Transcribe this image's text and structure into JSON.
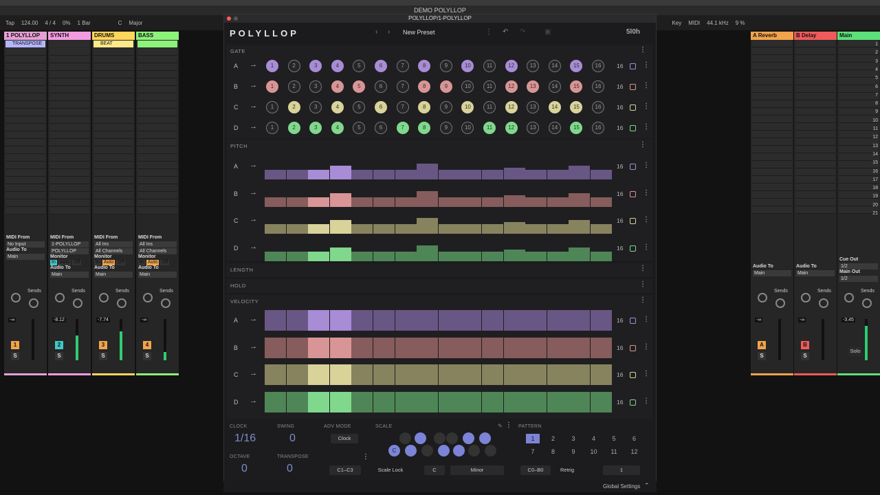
{
  "window": {
    "app_title": "DEMO POLYLLOP",
    "plugin_title": "POLYLLOP/1-POLYLLOP"
  },
  "transport": {
    "tap": "Tap",
    "bpm": "124.00",
    "sig": "4 / 4",
    "zoom": "0%",
    "quant": "1 Bar",
    "key": "C",
    "scale": "Major",
    "key_label": "Key",
    "midi": "MIDI",
    "rate": "44.1 kHz",
    "cpu": "9 %"
  },
  "tracks": [
    {
      "name": "1 POLYLLOP",
      "color": "#e6a0d6",
      "clip": "TRANSPOSE",
      "clip_color": "#b5b5ff",
      "from_label": "MIDI From",
      "from": "No Input",
      "audio_to": "Audio To",
      "out": "Main",
      "num": "1",
      "vol": "-∞",
      "num_color": "#f2a34b",
      "s": "S"
    },
    {
      "name": "SYNTH",
      "color": "#f39be0",
      "clip": "",
      "clip_color": "",
      "from_label": "MIDI From",
      "from": "1-POLYLLOP",
      "from2": "POLYLLOP",
      "monitor": "Monitor",
      "mon": [
        "In",
        "Auto",
        "Off"
      ],
      "audio_to": "Audio To",
      "out": "Main",
      "num": "2",
      "vol": "-8.12",
      "num_color": "#3fc8c8",
      "s": "S"
    },
    {
      "name": "DRUMS",
      "color": "#ffd65c",
      "clip": "BEAT",
      "clip_color": "#ffe88a",
      "from_label": "MIDI From",
      "from": "All Ins",
      "from2": "All Channels",
      "monitor": "Monitor",
      "mon": [
        "In",
        "Auto",
        "Off"
      ],
      "audio_to": "Audio To",
      "out": "Main",
      "num": "3",
      "vol": "-7.74",
      "num_color": "#f2a34b",
      "s": "S",
      "scene": [
        "5",
        "8"
      ]
    },
    {
      "name": "BASS",
      "color": "#8df27a",
      "clip": "",
      "clip_color": "#8df27a",
      "from_label": "MIDI From",
      "from": "All Ins",
      "from2": "All Channels",
      "monitor": "Monitor",
      "mon": [
        "In",
        "Auto",
        "Off"
      ],
      "audio_to": "Audio To",
      "out": "Main",
      "num": "4",
      "vol": "-∞",
      "num_color": "#f2a34b",
      "s": "S"
    }
  ],
  "returns": [
    {
      "name": "A Reverb",
      "color": "#f2a34b",
      "audio_to": "Audio To",
      "out": "Main",
      "letter": "A",
      "vol": "-∞",
      "s": "S"
    },
    {
      "name": "B Delay",
      "color": "#f05a5a",
      "audio_to": "Audio To",
      "out": "Main",
      "letter": "B",
      "vol": "-∞",
      "s": "S"
    },
    {
      "name": "Main",
      "color": "#5ce07a",
      "cue": "Cue Out",
      "cue_val": "1/2",
      "main_out": "Main Out",
      "main_val": "1/2",
      "vol": "-3.45",
      "solo": "Solo"
    }
  ],
  "sends_label": "Sends",
  "scene_numbers": [
    "1",
    "2",
    "3",
    "4",
    "5",
    "6",
    "7",
    "8",
    "9",
    "10",
    "11",
    "12",
    "13",
    "14",
    "15",
    "16",
    "17",
    "18",
    "19",
    "20",
    "21"
  ],
  "plugin": {
    "logo": "POLYLLOP",
    "preset": "New Preset",
    "brand": "5l0h",
    "sections": {
      "gate": "GATE",
      "pitch": "PITCH",
      "length": "LENGTH",
      "hold": "HOLD",
      "velocity": "VELOCITY"
    },
    "rows": [
      "A",
      "B",
      "C",
      "D"
    ],
    "row_colors": [
      "#a88cd6",
      "#d99595",
      "#d9d39a",
      "#7fd88c"
    ],
    "steps": [
      "1",
      "2",
      "3",
      "4",
      "5",
      "6",
      "7",
      "8",
      "9",
      "10",
      "11",
      "12",
      "13",
      "14",
      "15",
      "16"
    ],
    "row_length": "16",
    "gate_on": [
      [
        1,
        0,
        1,
        1,
        0,
        1,
        0,
        1,
        0,
        1,
        0,
        1,
        0,
        0,
        1,
        0
      ],
      [
        1,
        0,
        0,
        1,
        1,
        0,
        0,
        1,
        1,
        0,
        0,
        1,
        1,
        0,
        1,
        0
      ],
      [
        0,
        1,
        0,
        1,
        0,
        1,
        0,
        1,
        0,
        1,
        0,
        1,
        0,
        1,
        1,
        0
      ],
      [
        0,
        1,
        1,
        1,
        0,
        0,
        1,
        1,
        0,
        0,
        1,
        1,
        0,
        0,
        1,
        0
      ]
    ],
    "pitch_levels": [
      2,
      2,
      2,
      4,
      2,
      2,
      2,
      5,
      2,
      2,
      2,
      3,
      2,
      2,
      4,
      2
    ],
    "velocity_levels": [
      0.8,
      0.8,
      1,
      1,
      0.8,
      0.8,
      0.8,
      0.8,
      0.8,
      0.8,
      0.8,
      0.8,
      0.8,
      0.8,
      0.8,
      0.8
    ],
    "bottom": {
      "clock_label": "CLOCK",
      "clock": "1/16",
      "swing_label": "SWING",
      "swing": "0",
      "adv_label": "ADV MODE",
      "adv": "Clock",
      "octave_label": "OCTAVE",
      "octave": "0",
      "transpose_label": "TRANSPOSE",
      "transpose": "0",
      "range": "C1–C3",
      "scale_label": "SCALE",
      "scale_lock": "Scale Lock",
      "root": "C",
      "mode": "Minor",
      "scale_root_note": "C",
      "pattern_label": "PATTERN",
      "patterns": [
        "1",
        "2",
        "3",
        "4",
        "5",
        "6",
        "7",
        "8",
        "9",
        "10",
        "11",
        "12"
      ],
      "pattern_range": "C0–B0",
      "retrig": "Retrig",
      "pattern_num": "1"
    },
    "global": "Global Settings"
  }
}
